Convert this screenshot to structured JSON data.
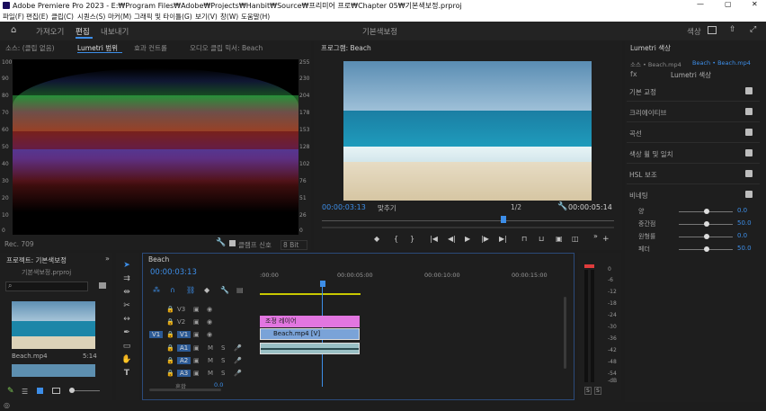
{
  "titlebar": {
    "title": "Adobe Premiere Pro 2023 - E:₩Program Files₩Adobe₩Projects₩Hanbit₩Source₩프리미어 프로₩Chapter 05₩기본색보정.prproj",
    "min": "—",
    "max": "▢",
    "close": "✕"
  },
  "menu": [
    "파일(F)",
    "편집(E)",
    "클립(C)",
    "시퀀스(S)",
    "마커(M)",
    "그래픽 및 타이틀(G)",
    "보기(V)",
    "창(W)",
    "도움말(H)"
  ],
  "workspace": {
    "tabs": [
      "가져오기",
      "편집",
      "내보내기"
    ],
    "center": "기본색보정",
    "right_label": "색상"
  },
  "source_panel": {
    "tabs": [
      "소스: (클립 없음)",
      "Lumetri 범위",
      "효과 컨트롤",
      "오디오 클립 믹서: Beach"
    ],
    "left_scale": [
      "100",
      "90",
      "80",
      "70",
      "60",
      "50",
      "40",
      "30",
      "20",
      "10",
      "0"
    ],
    "right_scale": [
      "255",
      "230",
      "204",
      "178",
      "153",
      "128",
      "102",
      "76",
      "51",
      "26",
      "0"
    ],
    "footer_left": "Rec. 709",
    "footer_clamp": "클램프 신호",
    "footer_bits": "8 Bit"
  },
  "program": {
    "title": "프로그램: Beach",
    "timecode": "00:00:03:13",
    "fit": "맞추기",
    "quality": "1/2",
    "duration": "00:00:05:14"
  },
  "lumetri": {
    "title": "Lumetri 색상",
    "source": "소스 • Beach.mp4",
    "clip": "Beach • Beach.mp4",
    "fx": "Lumetri 색상",
    "sections": [
      "기본 교정",
      "크리에이티브",
      "곡선",
      "색상 휠 및 일치",
      "HSL 보조",
      "비네팅"
    ],
    "sliders": [
      {
        "label": "양",
        "value": "0.0",
        "pos": 0.5
      },
      {
        "label": "중간점",
        "value": "50.0",
        "pos": 0.5
      },
      {
        "label": "원형률",
        "value": "0.0",
        "pos": 0.5
      },
      {
        "label": "페더",
        "value": "50.0",
        "pos": 0.5
      }
    ]
  },
  "project": {
    "title": "프로젝트: 기본색보정",
    "file": "기본색보정.prproj",
    "clip_name": "Beach.mp4",
    "clip_dur": "5:14"
  },
  "timeline": {
    "tab": "Beach",
    "timecode": "00:00:03:13",
    "ruler": [
      ":00:00",
      "00:00:05:00",
      "00:00:10:00",
      "00:00:15:00"
    ],
    "video_tracks": [
      "V3",
      "V2",
      "V1"
    ],
    "audio_tracks": [
      "A1",
      "A2",
      "A3"
    ],
    "src_v": "V1",
    "src_a": "A1",
    "clip_adjust": "조정 레이어",
    "clip_video": "Beach.mp4 [V]",
    "mix": "혼합",
    "mix_val": "0.0"
  },
  "meter": {
    "scale": [
      "0",
      "-6",
      "-12",
      "-18",
      "-24",
      "-30",
      "-36",
      "-42",
      "-48",
      "-54",
      "-dB"
    ],
    "solo": [
      "S",
      "S"
    ]
  }
}
